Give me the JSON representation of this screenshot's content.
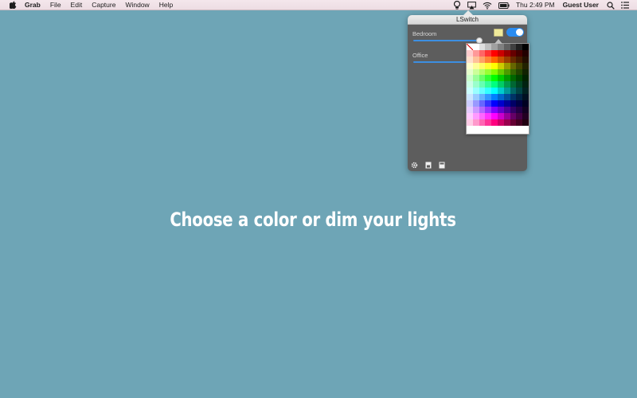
{
  "menubar": {
    "apple_icon": "apple-logo",
    "items": [
      "Grab",
      "File",
      "Edit",
      "Capture",
      "Window",
      "Help"
    ],
    "status_icons": [
      "lswitch-lightbulb-icon",
      "airplay-icon",
      "wifi-icon",
      "battery-icon"
    ],
    "clock": "Thu 2:49 PM",
    "user": "Guest User",
    "spotlight_icon": "search-icon",
    "notification_icon": "notification-center-icon"
  },
  "popover": {
    "title": "LSwitch",
    "lights": [
      {
        "name": "Bedroom",
        "brightness_percent": 95,
        "on": true,
        "color": "#f0ea9a"
      },
      {
        "name": "Office",
        "brightness_percent": 95
      }
    ],
    "color_grid": [
      [
        "none",
        "#ffffff",
        "#e0e0e0",
        "#c0c0c0",
        "#a0a0a0",
        "#808080",
        "#606060",
        "#404040",
        "#202020",
        "#000000"
      ],
      [
        "#ffcccc",
        "#ff9999",
        "#ff6666",
        "#ff3333",
        "#ff0000",
        "#cc0000",
        "#990000",
        "#660000",
        "#440000",
        "#220000"
      ],
      [
        "#ffe0cc",
        "#ffc199",
        "#ffa266",
        "#ff8333",
        "#ff6600",
        "#cc5200",
        "#993d00",
        "#662900",
        "#441b00",
        "#220e00"
      ],
      [
        "#ffffcc",
        "#ffff99",
        "#ffff66",
        "#ffff33",
        "#ffff00",
        "#cccc00",
        "#999900",
        "#666600",
        "#444400",
        "#222200"
      ],
      [
        "#e6ffcc",
        "#ccff99",
        "#b3ff66",
        "#99ff33",
        "#80ff00",
        "#66cc00",
        "#4d9900",
        "#336600",
        "#224400",
        "#112200"
      ],
      [
        "#ccffcc",
        "#99ff99",
        "#66ff66",
        "#33ff33",
        "#00ff00",
        "#00cc00",
        "#009900",
        "#006600",
        "#004400",
        "#002200"
      ],
      [
        "#ccffe6",
        "#99ffcc",
        "#66ffb3",
        "#33ff99",
        "#00ff80",
        "#00cc66",
        "#00994d",
        "#006633",
        "#004422",
        "#002211"
      ],
      [
        "#ccffff",
        "#99ffff",
        "#66ffff",
        "#33ffff",
        "#00ffff",
        "#00cccc",
        "#009999",
        "#006666",
        "#004444",
        "#002222"
      ],
      [
        "#cce6ff",
        "#99ccff",
        "#66b3ff",
        "#3399ff",
        "#0080ff",
        "#0066cc",
        "#004d99",
        "#003366",
        "#002244",
        "#001122"
      ],
      [
        "#ccccff",
        "#9999ff",
        "#6666ff",
        "#3333ff",
        "#0000ff",
        "#0000cc",
        "#000099",
        "#000066",
        "#000044",
        "#000022"
      ],
      [
        "#e6ccff",
        "#cc99ff",
        "#b366ff",
        "#9933ff",
        "#8000ff",
        "#6600cc",
        "#4d0099",
        "#330066",
        "#220044",
        "#110022"
      ],
      [
        "#ffccff",
        "#ff99ff",
        "#ff66ff",
        "#ff33ff",
        "#ff00ff",
        "#cc00cc",
        "#990099",
        "#660066",
        "#440044",
        "#220022"
      ],
      [
        "#ffcce6",
        "#ff99cc",
        "#ff66b3",
        "#ff3399",
        "#ff0080",
        "#cc0066",
        "#99004d",
        "#660033",
        "#440022",
        "#220011"
      ]
    ],
    "footer_icons": [
      "gear-icon",
      "device-icon",
      "device-settings-icon"
    ]
  },
  "headline": "Choose a color or dim your lights",
  "colors": {
    "desktop": "#6ea5b6",
    "panel": "#5d5d5d",
    "accent": "#2a8cf0"
  }
}
